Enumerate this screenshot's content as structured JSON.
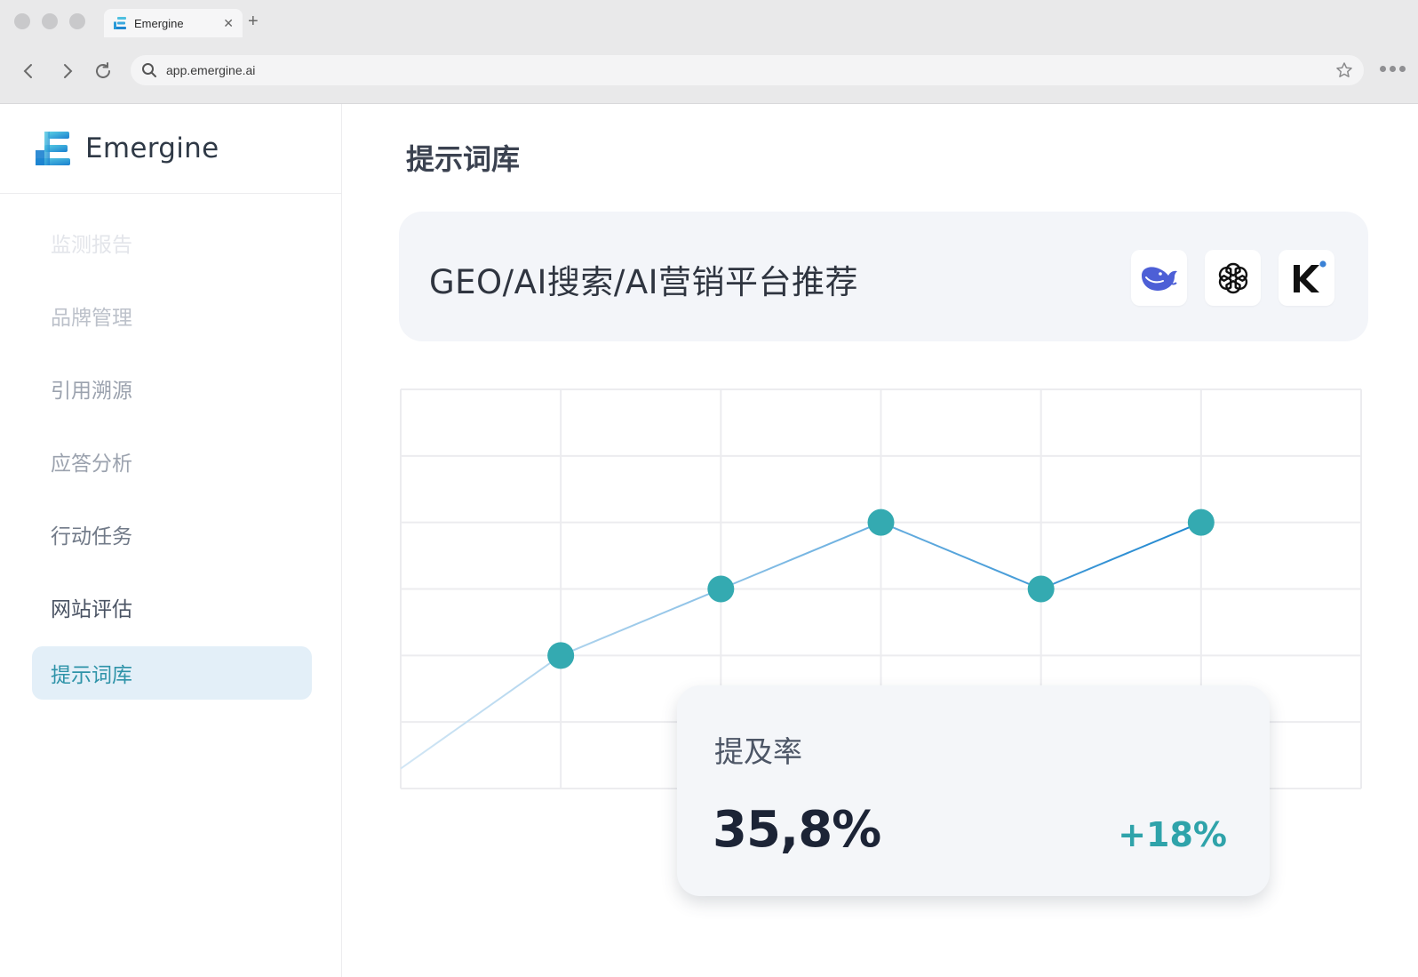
{
  "browser": {
    "tab_title": "Emergine",
    "tab_close": "✕",
    "new_tab": "+",
    "url": "app.emergine.ai"
  },
  "sidebar": {
    "brand": "Emergine",
    "items": [
      {
        "label": "监测报告"
      },
      {
        "label": "品牌管理"
      },
      {
        "label": "引用溯源"
      },
      {
        "label": "应答分析"
      },
      {
        "label": "行动任务"
      },
      {
        "label": "网站评估"
      },
      {
        "label": "提示词库",
        "active": true
      }
    ]
  },
  "main": {
    "title": "提示词库",
    "prompt": "GEO/AI搜索/AI营销平台推荐",
    "ai_icons": [
      "deepseek-icon",
      "openai-icon",
      "kimi-icon"
    ]
  },
  "chart_data": {
    "type": "line",
    "grid": true,
    "rows": 6,
    "cols": 6,
    "points": [
      {
        "x": 0,
        "y": 0.3
      },
      {
        "x": 1,
        "y": 2
      },
      {
        "x": 2,
        "y": 3
      },
      {
        "x": 3,
        "y": 4
      },
      {
        "x": 4,
        "y": 3
      },
      {
        "x": 5,
        "y": 4
      }
    ],
    "ylim": [
      0,
      6
    ],
    "marker_color": "#34aab1",
    "line_color_start": "#d3e7f5",
    "line_color_end": "#1f87d0"
  },
  "metric": {
    "label": "提及率",
    "value": "35,8%",
    "change": "+18%"
  },
  "colors": {
    "accent": "#2e93a8",
    "active_bg": "#e3eff8",
    "card_bg": "#f3f5f9"
  }
}
